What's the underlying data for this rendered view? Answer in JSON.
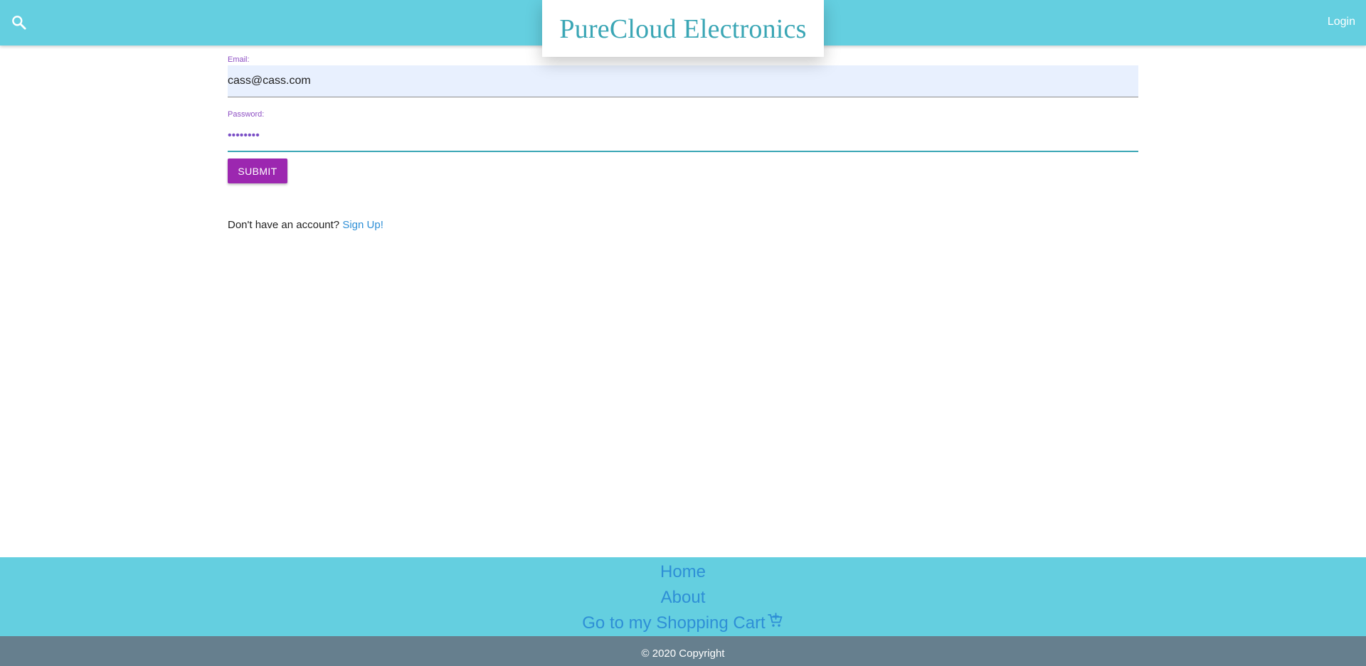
{
  "header": {
    "logo_text": "PureCloud Electronics",
    "login_label": "Login",
    "search_icon": "search-icon",
    "bar_color": "#64cfe0"
  },
  "form": {
    "email_label": "Email:",
    "email_value": "cass@cass.com",
    "password_label": "Password:",
    "password_value": "••••••••",
    "submit_label": "SUBMIT",
    "submit_color": "#9c27b0"
  },
  "signup": {
    "prompt": "Don't have an account?",
    "link_label": "Sign Up!"
  },
  "footer": {
    "links": [
      "Home",
      "About",
      "Go to my Shopping Cart"
    ],
    "cart_icon": "shopping-cart-icon",
    "copyright": "© 2020 Copyright"
  }
}
